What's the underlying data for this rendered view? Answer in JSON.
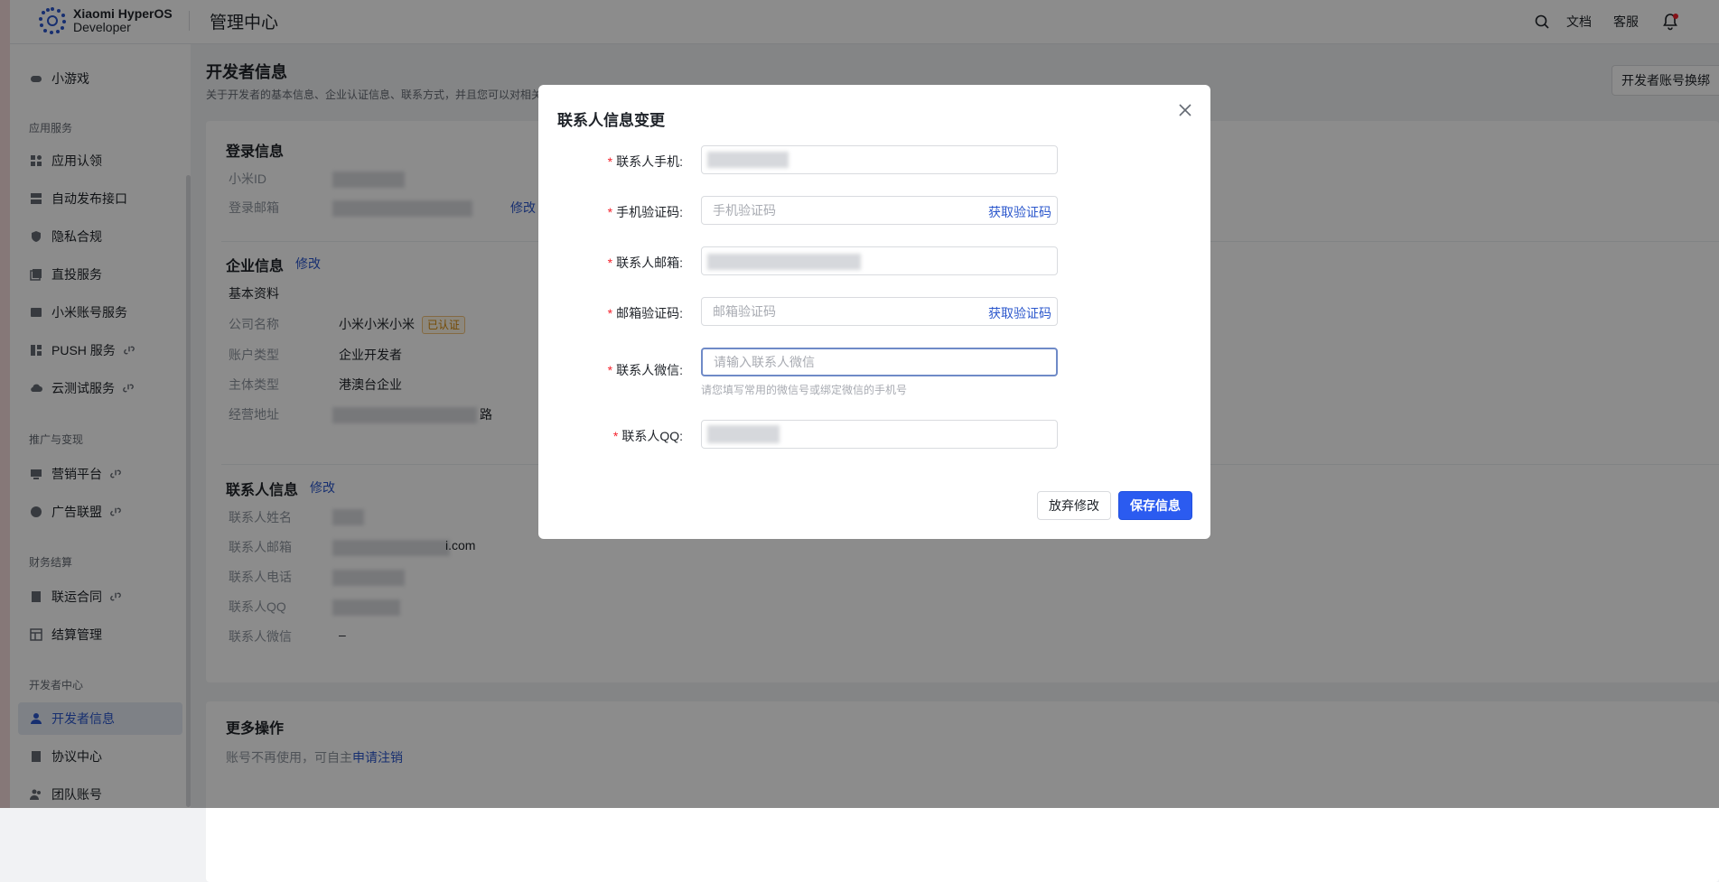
{
  "header": {
    "brand_line1": "Xiaomi HyperOS",
    "brand_line2": "Developer",
    "page_title": "管理中心",
    "docs": "文档",
    "support": "客服"
  },
  "sidebar": {
    "item_minigame": "小游戏",
    "group_app": "应用服务",
    "item_app_claim": "应用认领",
    "item_auto_publish": "自动发布接口",
    "item_privacy": "隐私合规",
    "item_direct": "直投服务",
    "item_account": "小米账号服务",
    "item_push": "PUSH 服务",
    "item_cloud_test": "云测试服务",
    "group_promo": "推广与变现",
    "item_marketing": "营销平台",
    "item_ads": "广告联盟",
    "group_finance": "财务结算",
    "item_contract": "联运合同",
    "item_settlement": "结算管理",
    "group_dev": "开发者中心",
    "item_dev_info": "开发者信息",
    "item_agreement": "协议中心",
    "item_team": "团队账号"
  },
  "main": {
    "title": "开发者信息",
    "desc": "关于开发者的基本信息、企业认证信息、联系方式，并且您可以对相关",
    "swap_button": "开发者账号换绑",
    "login": {
      "title": "登录信息",
      "mi_id_label": "小米ID",
      "email_label": "登录邮箱",
      "edit": "修改"
    },
    "company": {
      "title": "企业信息",
      "edit": "修改",
      "sub_title": "基本资料",
      "name_label": "公司名称",
      "name_value": "小米小米小米",
      "verified_badge": "已认证",
      "account_type_label": "账户类型",
      "account_type_value": "企业开发者",
      "entity_label": "主体类型",
      "entity_value": "港澳台企业",
      "address_label": "经营地址",
      "address_suffix": "路"
    },
    "contact": {
      "title": "联系人信息",
      "edit": "修改",
      "name_label": "联系人姓名",
      "email_label": "联系人邮箱",
      "email_suffix": "i.com",
      "phone_label": "联系人电话",
      "qq_label": "联系人QQ",
      "wechat_label": "联系人微信",
      "wechat_value": "–"
    },
    "more": {
      "title": "更多操作",
      "text": "账号不再使用，可自主",
      "cancel_link": "申请注销"
    }
  },
  "modal": {
    "title": "联系人信息变更",
    "required_mark": "*",
    "phone_label": "联系人手机:",
    "phone_code_label": "手机验证码:",
    "phone_code_placeholder": "手机验证码",
    "get_code": "获取验证码",
    "email_label": "联系人邮箱:",
    "email_code_label": "邮箱验证码:",
    "email_code_placeholder": "邮箱验证码",
    "wechat_label": "联系人微信:",
    "wechat_placeholder": "请输入联系人微信",
    "wechat_help": "请您填写常用的微信号或绑定微信的手机号",
    "qq_label": "联系人QQ:",
    "cancel_button": "放弃修改",
    "save_button": "保存信息"
  },
  "colors": {
    "primary": "#2b5bf0",
    "link": "#2b57cc",
    "required": "#f5222d",
    "overlay": "rgba(0,0,0,0.45)"
  }
}
